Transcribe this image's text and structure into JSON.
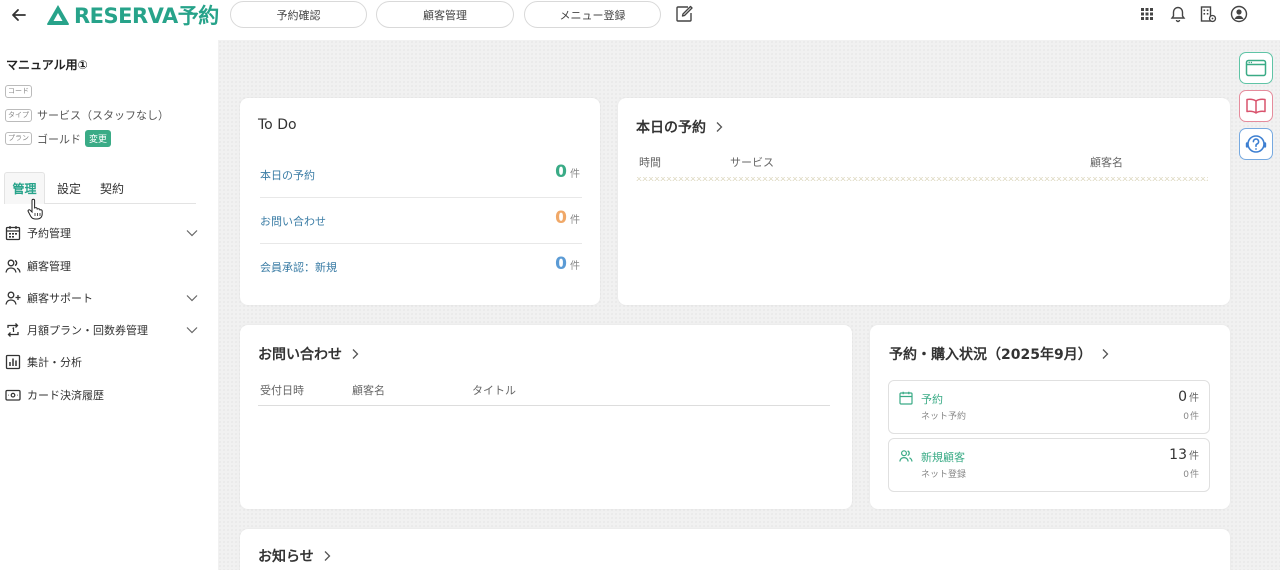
{
  "header": {
    "logo_text": "RESERVA予約",
    "nav": [
      "予約確認",
      "顧客管理",
      "メニュー登録"
    ]
  },
  "sidebar": {
    "shop_name": "マニュアル用①",
    "code_tag": "コード",
    "type_tag": "タイプ",
    "type_value": "サービス（スタッフなし）",
    "plan_tag": "プラン",
    "plan_value": "ゴールド",
    "change_label": "変更",
    "tabs": [
      "管理",
      "設定",
      "契約"
    ],
    "menu": [
      "予約管理",
      "顧客管理",
      "顧客サポート",
      "月額プラン・回数券管理",
      "集計・分析",
      "カード決済履歴"
    ]
  },
  "todo": {
    "title": "To Do",
    "unit": "件",
    "rows": [
      {
        "label": "本日の予約",
        "value": "0",
        "color": "#3aab86"
      },
      {
        "label": "お問い合わせ",
        "value": "0",
        "color": "#f0a868"
      },
      {
        "label": "会員承認：新規",
        "value": "0",
        "color": "#5b9bd5"
      }
    ]
  },
  "today": {
    "title": "本日の予約",
    "columns": [
      "時間",
      "サービス",
      "顧客名"
    ]
  },
  "inquiry": {
    "title": "お問い合わせ",
    "columns": [
      "受付日時",
      "顧客名",
      "タイトル"
    ]
  },
  "status": {
    "title": "予約・購入状況（2025年9月）",
    "unit": "件",
    "items": [
      {
        "label": "予約",
        "sub": "ネット予約",
        "value": "0",
        "sub_value": "0"
      },
      {
        "label": "新規顧客",
        "sub": "ネット登録",
        "value": "13",
        "sub_value": "0"
      }
    ]
  },
  "news": {
    "title": "お知らせ"
  },
  "colors": {
    "brand": "#27a38a",
    "accent": "#3aab86"
  }
}
